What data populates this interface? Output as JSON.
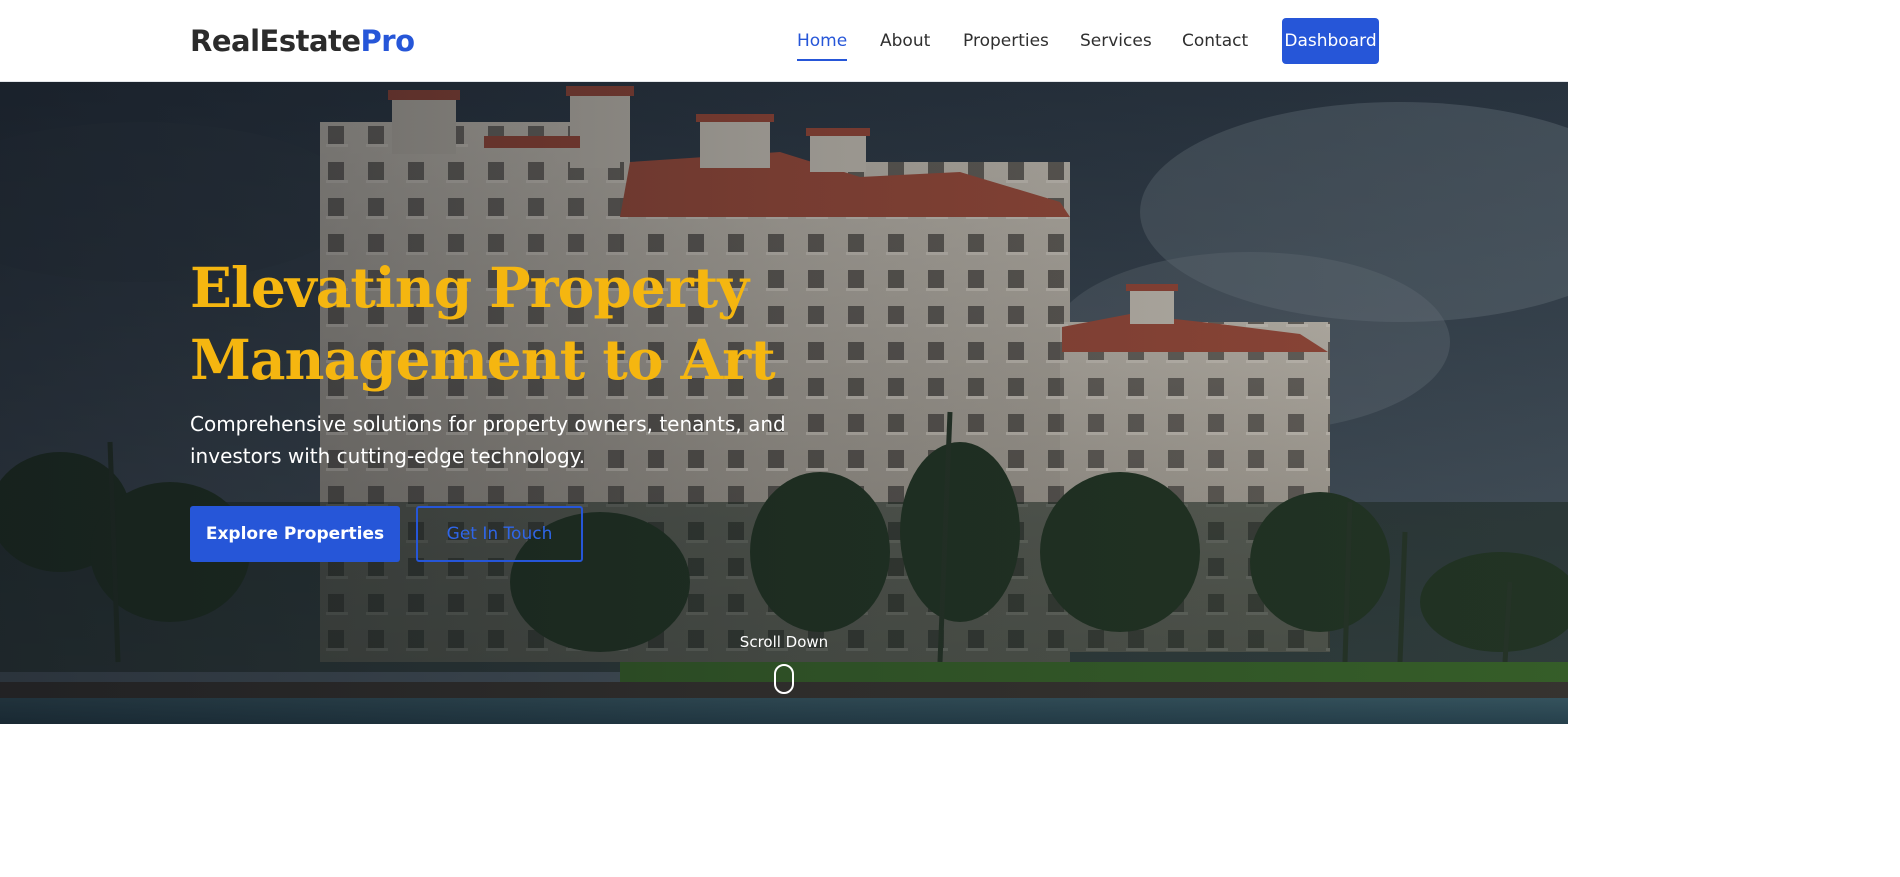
{
  "brand": {
    "name": "RealEstate",
    "accent": "Pro"
  },
  "nav": {
    "links": [
      "Home",
      "About",
      "Properties",
      "Services",
      "Contact"
    ],
    "active": "Home",
    "cta_label": "Dashboard"
  },
  "hero": {
    "title_lines": [
      "Elevating Property",
      "Management to Art"
    ],
    "subtitle_lines": [
      "Comprehensive solutions for property owners, tenants, and",
      "investors with cutting-edge technology."
    ],
    "primary_button": "Explore Properties",
    "secondary_button": "Get In Touch",
    "scroll_label": "Scroll Down",
    "background_image": "coastal-apartment-buildings-photo"
  },
  "colors": {
    "primary": "#2656d8",
    "title_gold": "#f5b610",
    "text_dark": "#2f2f2f"
  },
  "icons": {
    "scroll": "mouse-scroll-icon"
  }
}
